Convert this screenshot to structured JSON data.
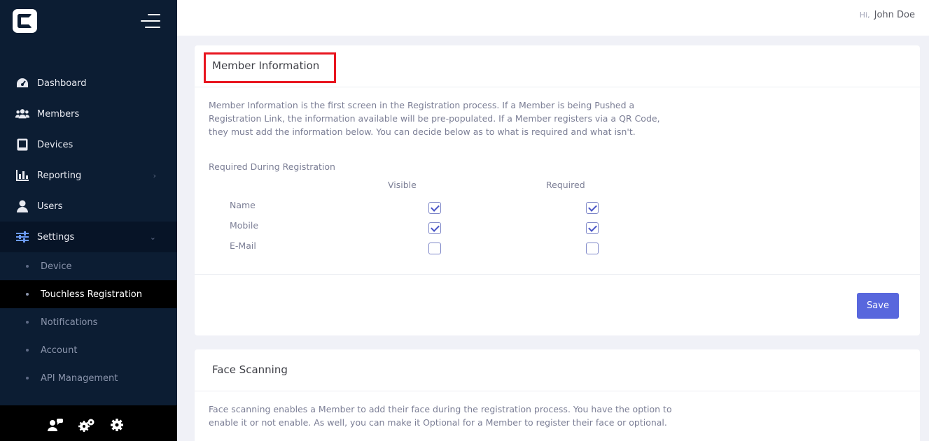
{
  "header": {
    "greeting": "Hi,",
    "user_name": "John Doe"
  },
  "sidebar": {
    "items": [
      {
        "label": "Dashboard",
        "icon": "speedometer-icon"
      },
      {
        "label": "Members",
        "icon": "users-icon"
      },
      {
        "label": "Devices",
        "icon": "tablet-icon"
      },
      {
        "label": "Reporting",
        "icon": "bar-chart-icon",
        "arrow": "›"
      },
      {
        "label": "Users",
        "icon": "user-icon"
      },
      {
        "label": "Settings",
        "icon": "sliders-icon",
        "arrow": "⌄"
      }
    ],
    "sub_items": [
      {
        "label": "Device"
      },
      {
        "label": "Touchless Registration"
      },
      {
        "label": "Notifications"
      },
      {
        "label": "Account"
      },
      {
        "label": "API Management"
      }
    ],
    "footer_icons": [
      "user-chat-icon",
      "gears-icon",
      "gear-icon"
    ]
  },
  "member_info": {
    "title": "Member Information",
    "description": "Member Information is the first screen in the Registration process. If a Member is being Pushed a Registration Link, the information available will be pre-populated. If a Member registers via a QR Code, they must add the information below. You can decide below as to what is required and what isn't.",
    "required_label": "Required During Registration",
    "columns": {
      "visible": "Visible",
      "required": "Required"
    },
    "rows": [
      {
        "label": "Name",
        "visible": true,
        "required": true
      },
      {
        "label": "Mobile",
        "visible": true,
        "required": true
      },
      {
        "label": "E-Mail",
        "visible": false,
        "required": false
      }
    ],
    "save_label": "Save"
  },
  "face_scanning": {
    "title": "Face Scanning",
    "description": "Face scanning enables a Member to add their face during the registration process. You have the option to enable it or not enable. As well, you can make it Optional for a Member to register their face or optional."
  },
  "colors": {
    "sidebar_bg": "#0c1d33",
    "accent": "#5867dd",
    "highlight_box": "#e8151f"
  }
}
